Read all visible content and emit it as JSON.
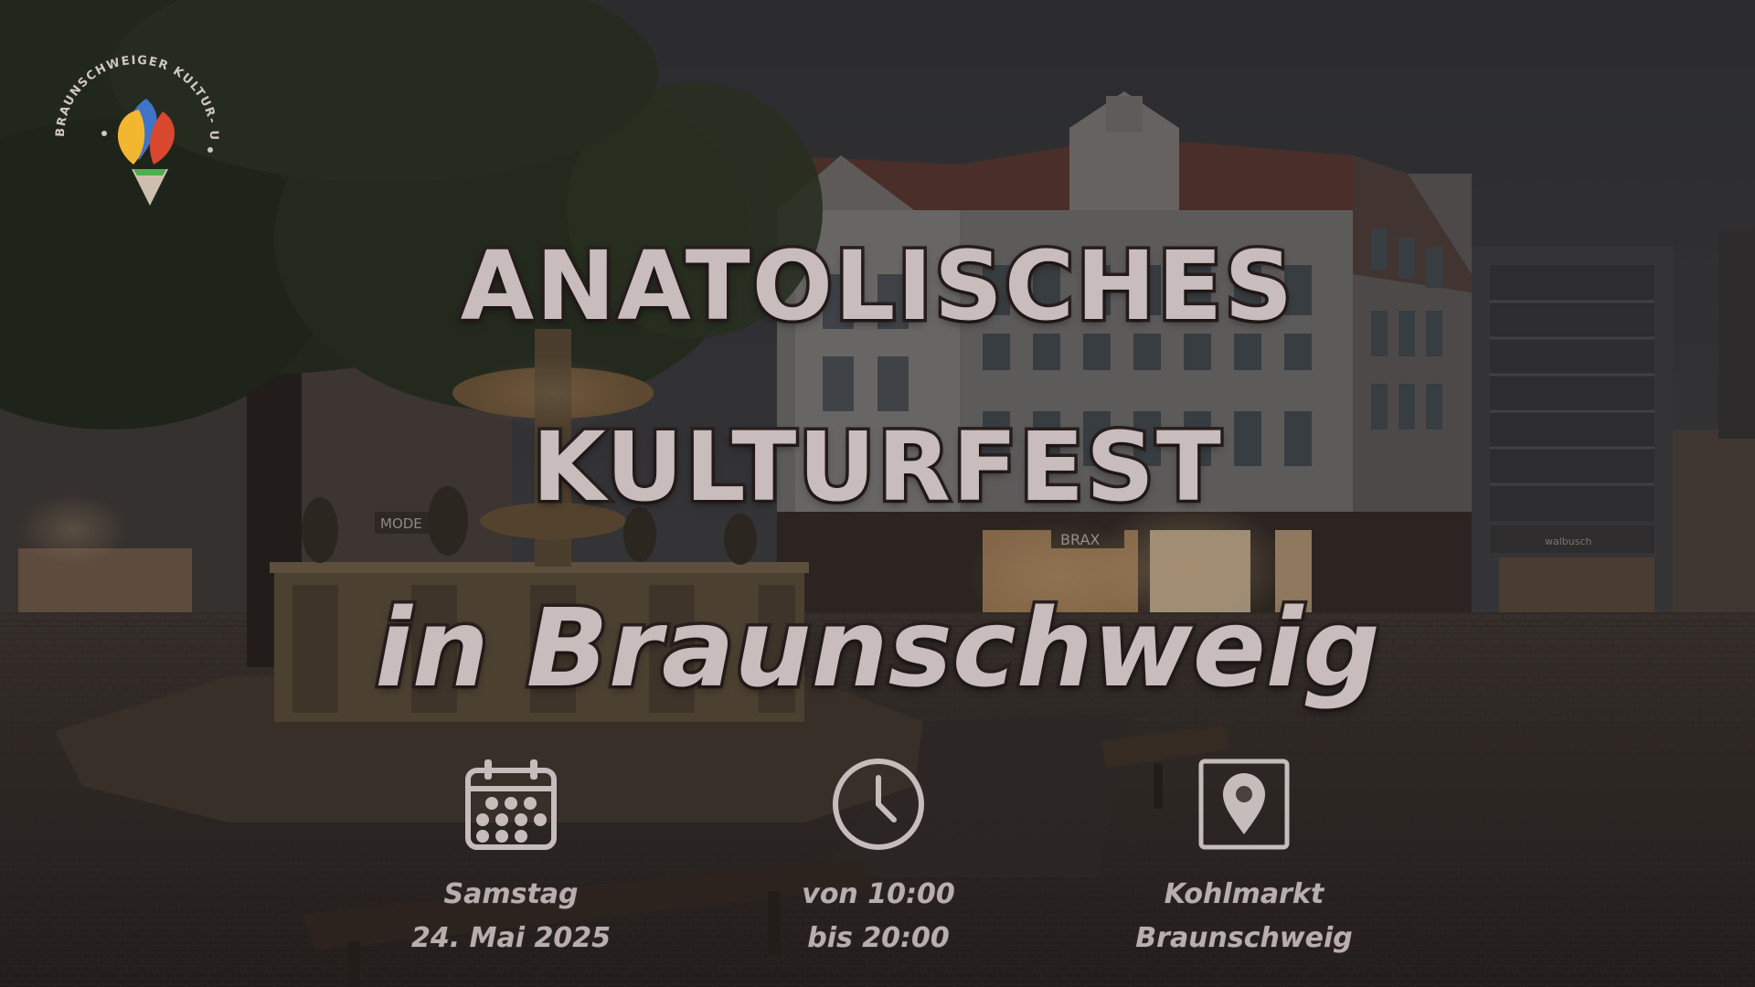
{
  "logo": {
    "arc_text": "BRAUNSCHWEIGER KULTUR- UND BILDUNGSHAUS",
    "icon": "tulip-flame-logo"
  },
  "headline": {
    "line1": "ANATOLISCHES",
    "line2": "KULTURFEST",
    "line3": "in Braunschweig"
  },
  "info": {
    "date": {
      "icon": "calendar-icon",
      "line1": "Samstag",
      "line2": "24. Mai 2025"
    },
    "time": {
      "icon": "clock-icon",
      "line1": "von 10:00",
      "line2": "bis 20:00"
    },
    "location": {
      "icon": "map-pin-icon",
      "line1": "Kohlmarkt",
      "line2": "Braunschweig"
    }
  },
  "storefront_signs": [
    "BRAX",
    "MODE",
    "walbusch"
  ],
  "colors": {
    "headline_fill": "#c9bcbc",
    "headline_stroke": "#2a211f",
    "info_text": "#b9aeae",
    "icon_stroke": "#c7bcbc"
  }
}
